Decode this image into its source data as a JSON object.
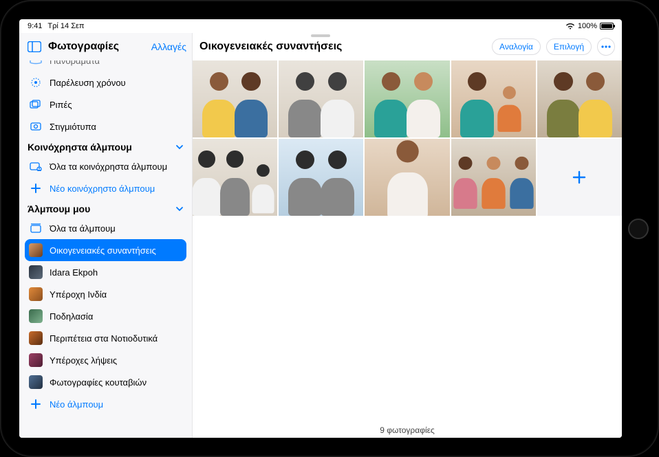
{
  "statusbar": {
    "time": "9:41",
    "date": "Τρί 14 Σεπ",
    "battery_pct": "100%"
  },
  "sidebar": {
    "title": "Φωτογραφίες",
    "edit_label": "Αλλαγές",
    "media_types": {
      "items": [
        {
          "label": "Πανοράματα"
        },
        {
          "label": "Παρέλευση χρόνου"
        },
        {
          "label": "Ριπές"
        },
        {
          "label": "Στιγμιότυπα"
        }
      ]
    },
    "shared": {
      "header": "Κοινόχρηστα άλμπουμ",
      "all_label": "Όλα τα κοινόχρηστα άλμπουμ",
      "new_label": "Νέο κοινόχρηστο άλμπουμ"
    },
    "my_albums": {
      "header": "Άλμπουμ μου",
      "all_label": "Όλα τα άλμπουμ",
      "items": [
        {
          "label": "Οικογενειακές συναντήσεις",
          "selected": true
        },
        {
          "label": "Idara Ekpoh"
        },
        {
          "label": "Υπέροχη Ινδία"
        },
        {
          "label": "Ποδηλασία"
        },
        {
          "label": "Περιπέτεια στα Νοτιοδυτικά"
        },
        {
          "label": "Υπέροχες λήψεις"
        },
        {
          "label": "Φωτογραφίες κουταβιών"
        }
      ],
      "new_label": "Νέο άλμπουμ"
    }
  },
  "main": {
    "title": "Οικογενειακές συναντήσεις",
    "aspect_label": "Αναλογία",
    "select_label": "Επιλογή",
    "footer": "9 φωτογραφίες"
  }
}
